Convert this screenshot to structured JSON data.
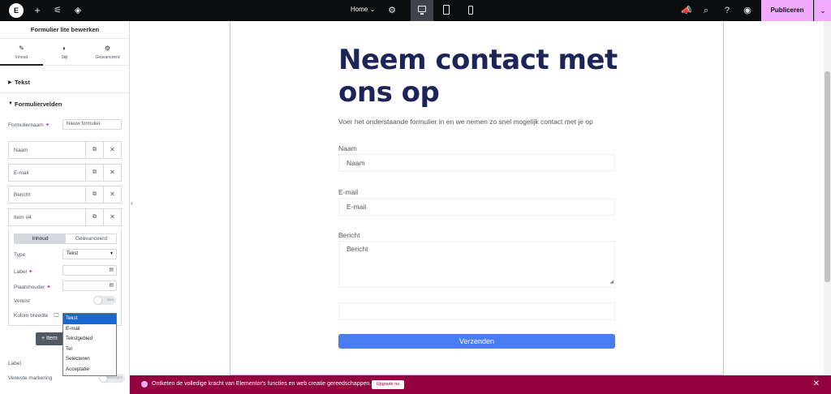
{
  "topbar": {
    "logo": "E",
    "page_name": "Home",
    "publish_label": "Publiceren"
  },
  "panel": {
    "title": "Formulier lite bewerken",
    "tabs": [
      {
        "label": "Inhoud",
        "icon": "pencil-icon"
      },
      {
        "label": "Stijl",
        "icon": "half-circle-icon"
      },
      {
        "label": "Geavanceerd",
        "icon": "gear-icon"
      }
    ],
    "section_text": "Tekst",
    "section_fields": "Formuliervelden",
    "form_name_label": "Formuliernaam",
    "form_name_value": "Nieuw formulier",
    "items": [
      "Naam",
      "E-mail",
      "Bericht",
      "Item #4"
    ],
    "item_switch": [
      "Inhoud",
      "Geavanceerd"
    ],
    "type_label": "Type",
    "type_value": "Tekst",
    "label_label": "Label",
    "placeholder_label": "Plaatshouder",
    "required_label": "Vereist",
    "required_toggle": "Nee",
    "width_label": "Kolom breedte",
    "type_options": [
      "Tekst",
      "E-mail",
      "Tekstgebied",
      "Tel",
      "Selecteren",
      "Acceptatie"
    ],
    "add_item_label": "Item",
    "bottom_label": "Label",
    "required_marking_label": "Vereiste markering",
    "required_marking_toggle": "Verbergen"
  },
  "canvas": {
    "heading": "Neem contact met ons op",
    "description": "Voer het onderstaande formulier in en we nemen zo snel mogelijk contact met je op",
    "fields": [
      {
        "label": "Naam",
        "placeholder": "Naam"
      },
      {
        "label": "E-mail",
        "placeholder": "E-mail"
      },
      {
        "label": "Bericht",
        "placeholder": "Bericht"
      }
    ],
    "submit_label": "Verzenden"
  },
  "promo": {
    "text": "Ontketen de volledige kracht van Elementor's functies en web creatie gereedschappen.",
    "button": "Upgrade nu"
  },
  "colors": {
    "accent_pink": "#f0abfc",
    "promo_bg": "#93003f",
    "heading_navy": "#1d2457",
    "button_blue": "#4a7ef0"
  }
}
